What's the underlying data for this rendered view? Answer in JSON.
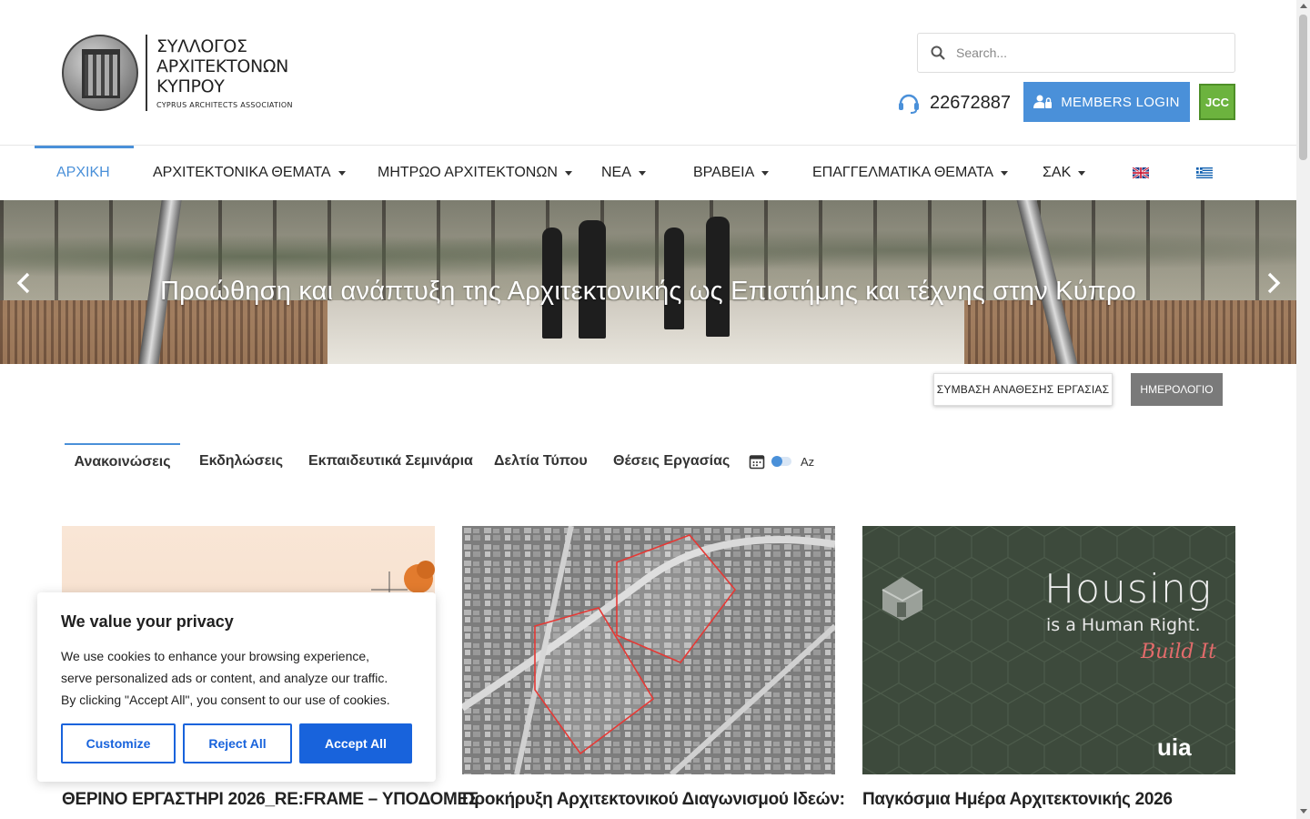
{
  "logo": {
    "line1": "ΣΥΛΛΟΓΟΣ",
    "line2": "ΑΡΧΙΤΕΚΤΟΝΩΝ",
    "line3": "ΚΥΠΡΟΥ",
    "subtitle": "CYPRUS ARCHITECTS ASSOCIATION"
  },
  "search": {
    "placeholder": "Search..."
  },
  "contact": {
    "phone": "22672887"
  },
  "members_login": "MEMBERS LOGIN",
  "jcc_badge": "JCC",
  "nav": {
    "items": [
      {
        "label": "ΑΡΧΙΚΗ",
        "active": true
      },
      {
        "label": "ΑΡΧΙΤΕΚΤΟΝΙΚΑ ΘΕΜΑΤΑ"
      },
      {
        "label": "ΜΗΤΡΩΟ ΑΡΧΙΤΕΚΤΟΝΩΝ"
      },
      {
        "label": "ΝΕΑ"
      },
      {
        "label": "ΒΡΑΒΕΙΑ"
      },
      {
        "label": "ΕΠΑΓΓΕΛΜΑΤΙΚΑ ΘΕΜΑΤΑ"
      },
      {
        "label": "ΣΑΚ"
      }
    ],
    "flags": [
      "uk-flag-icon",
      "greece-flag-icon"
    ]
  },
  "hero": {
    "caption": "Προώθηση και ανάπτυξη της Αρχιτεκτονικής ως Επιστήμης και τέχνης στην Κύπρο"
  },
  "actions": {
    "contract": "ΣΥΜΒΑΣΗ ΑΝΑΘΕΣΗΣ ΕΡΓΑΣΙΑΣ",
    "calendar": "ΗΜΕΡΟΛΟΓΙΟ"
  },
  "tabs": [
    {
      "label": "Ανακοινώσεις",
      "active": true
    },
    {
      "label": "Εκδηλώσεις"
    },
    {
      "label": "Εκπαιδευτικά Σεμινάρια"
    },
    {
      "label": "Δελτία Τύπου"
    },
    {
      "label": "Θέσεις Εργασίας"
    }
  ],
  "sort_toggle_label": "Az",
  "cards": [
    {
      "title": "ΘΕΡΙΝΟ ΕΡΓΑΣΤΗΡΙ 2026_RE:FRAME – ΥΠΟΔΟΜΕΣ"
    },
    {
      "title": "Προκήρυξη Αρχιτεκτονικού Διαγωνισμού Ιδεών:"
    },
    {
      "title": "Παγκόσμια Ημέρα Αρχιτεκτονικής 2026",
      "image_text": {
        "headline": "Housing",
        "sub": "is a Human Right.",
        "accent": "Build It",
        "brand": "uia"
      }
    }
  ],
  "cookie": {
    "title": "We value your privacy",
    "body": "We use cookies to enhance your browsing experience, serve personalized ads or content, and analyze our traffic. By clicking \"Accept All\", you consent to our use of cookies.",
    "customize": "Customize",
    "reject": "Reject All",
    "accept": "Accept All"
  },
  "colors": {
    "accent": "#4a90d9",
    "cookie_primary": "#1863dc",
    "jcc_green": "#6cb33e"
  }
}
